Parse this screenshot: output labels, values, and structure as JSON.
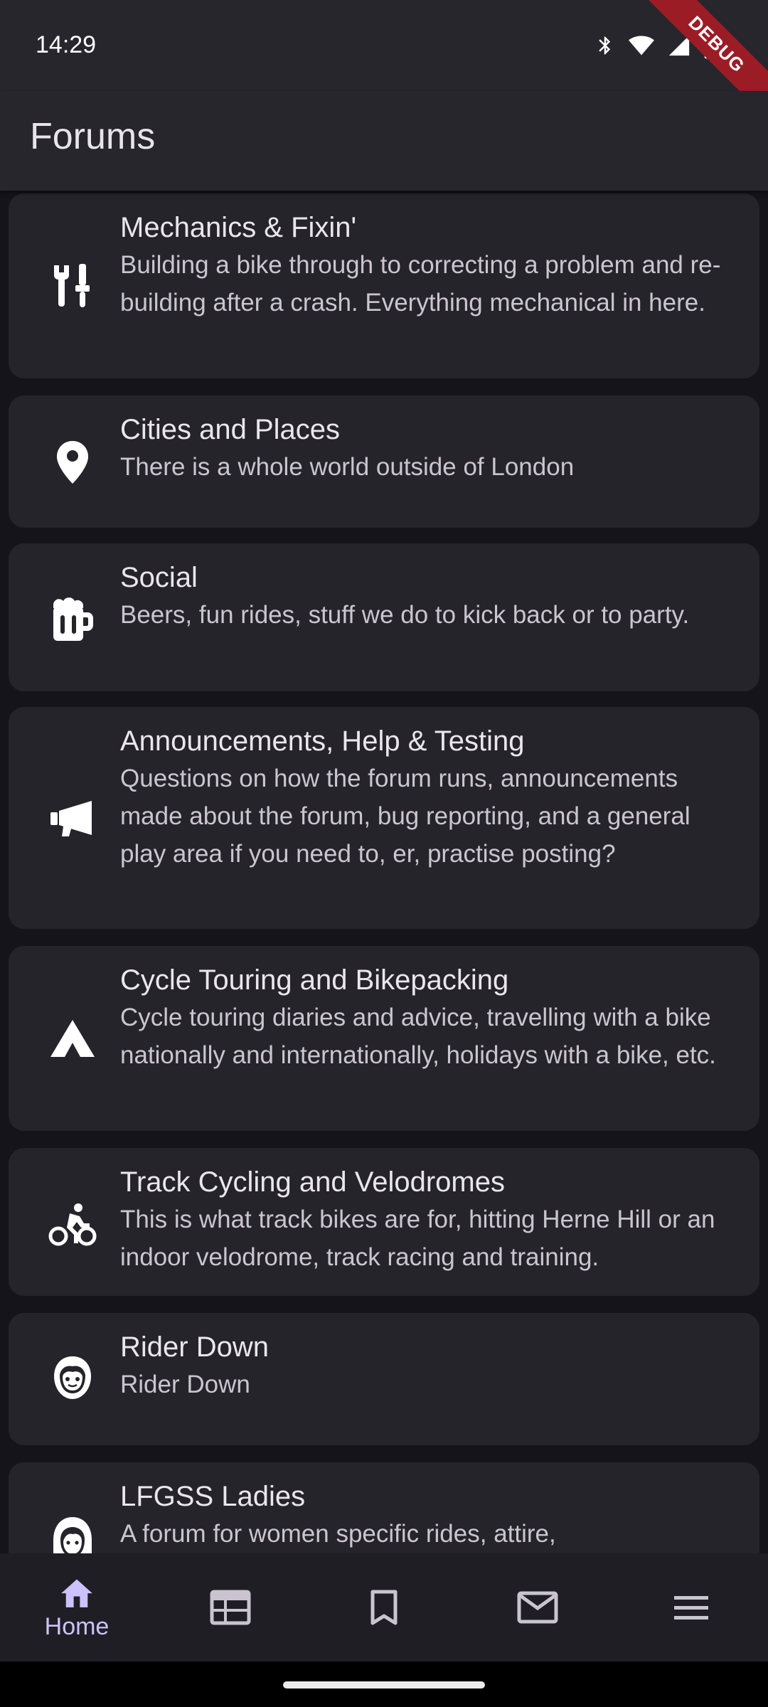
{
  "status": {
    "time": "14:29",
    "debug_label": "DEBUG"
  },
  "appbar": {
    "title": "Forums"
  },
  "forums": [
    {
      "title": "Mechanics & Fixin'",
      "description": "Building a bike through to correcting a problem and re-building after a crash. Everything mechanical in here.",
      "icon": "tools-icon"
    },
    {
      "title": "Cities and Places",
      "description": "There is a whole world outside of London",
      "icon": "map-pin-icon"
    },
    {
      "title": "Social",
      "description": "Beers, fun rides, stuff we do to kick back or to party.",
      "icon": "beer-mug-icon"
    },
    {
      "title": "Announcements, Help & Testing",
      "description": "Questions on how the forum runs, announcements made about the forum, bug reporting, and a general play area if you need to, er, practise posting?",
      "icon": "megaphone-icon"
    },
    {
      "title": "Cycle Touring and Bikepacking",
      "description": "Cycle touring diaries and advice, travelling with a bike nationally and internationally, holidays with a bike, etc.",
      "icon": "tent-icon"
    },
    {
      "title": "Track Cycling and Velodromes",
      "description": "This is what track bikes are for, hitting Herne Hill or an indoor velodrome, track racing and training.",
      "icon": "cyclist-icon"
    },
    {
      "title": "Rider Down",
      "description": "Rider Down",
      "icon": "face-icon"
    },
    {
      "title": "LFGSS Ladies",
      "description": "A forum for women specific rides, attire,",
      "icon": "woman-icon"
    }
  ],
  "nav": {
    "home_label": "Home",
    "items": [
      "home-icon",
      "calendar-icon",
      "bookmark-icon",
      "mail-icon",
      "menu-icon"
    ],
    "active_color": "#cdc2ff"
  }
}
